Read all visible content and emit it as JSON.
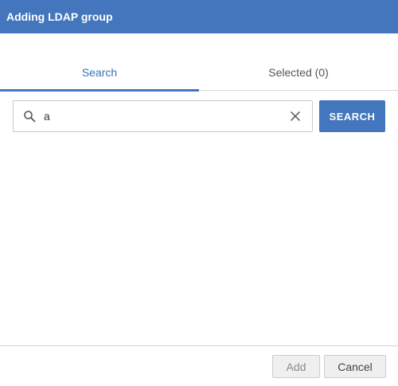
{
  "dialog": {
    "title": "Adding LDAP group"
  },
  "tabs": [
    {
      "label": "Search",
      "active": true
    },
    {
      "label": "Selected (0)",
      "active": false
    }
  ],
  "search": {
    "value": "a",
    "placeholder": "",
    "button_label": "SEARCH",
    "icon": "search-icon",
    "clear_icon": "close-icon"
  },
  "results": [],
  "footer": {
    "add_label": "Add",
    "cancel_label": "Cancel",
    "add_disabled": true
  },
  "colors": {
    "accent": "#4376bd",
    "active_tab_text": "#3a6fb8",
    "button_bg": "#efefef"
  }
}
